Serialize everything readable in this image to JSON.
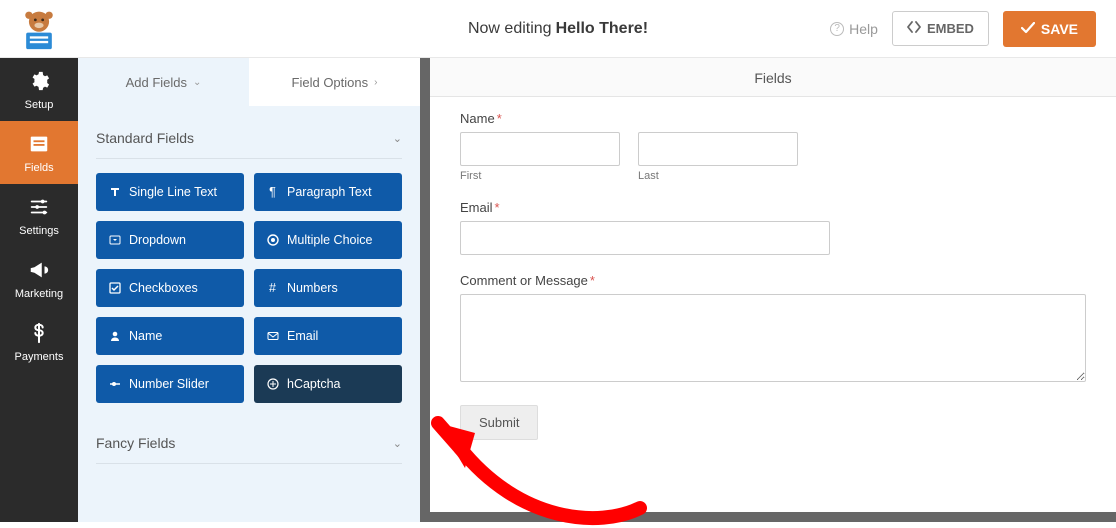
{
  "topbar": {
    "editing_prefix": "Now editing",
    "form_name": "Hello There!",
    "help": "Help",
    "embed": "EMBED",
    "save": "SAVE"
  },
  "leftnav": {
    "items": [
      {
        "key": "setup",
        "label": "Setup",
        "active": false
      },
      {
        "key": "fields",
        "label": "Fields",
        "active": true
      },
      {
        "key": "settings",
        "label": "Settings",
        "active": false
      },
      {
        "key": "marketing",
        "label": "Marketing",
        "active": false
      },
      {
        "key": "payments",
        "label": "Payments",
        "active": false
      }
    ]
  },
  "panel": {
    "tabs": {
      "add_fields": "Add Fields",
      "field_options": "Field Options"
    },
    "groups": {
      "standard": {
        "title": "Standard Fields",
        "fields": [
          {
            "label": "Single Line Text",
            "icon": "text-icon"
          },
          {
            "label": "Paragraph Text",
            "icon": "paragraph-icon"
          },
          {
            "label": "Dropdown",
            "icon": "dropdown-icon"
          },
          {
            "label": "Multiple Choice",
            "icon": "radio-icon"
          },
          {
            "label": "Checkboxes",
            "icon": "checkbox-icon"
          },
          {
            "label": "Numbers",
            "icon": "hash-icon"
          },
          {
            "label": "Name",
            "icon": "user-icon"
          },
          {
            "label": "Email",
            "icon": "envelope-icon"
          },
          {
            "label": "Number Slider",
            "icon": "slider-icon"
          },
          {
            "label": "hCaptcha",
            "icon": "shield-icon",
            "highlight": true
          }
        ]
      },
      "fancy": {
        "title": "Fancy Fields"
      }
    }
  },
  "preview": {
    "header": "Fields",
    "name_label": "Name",
    "first": "First",
    "last": "Last",
    "email_label": "Email",
    "comment_label": "Comment or Message",
    "submit": "Submit"
  }
}
